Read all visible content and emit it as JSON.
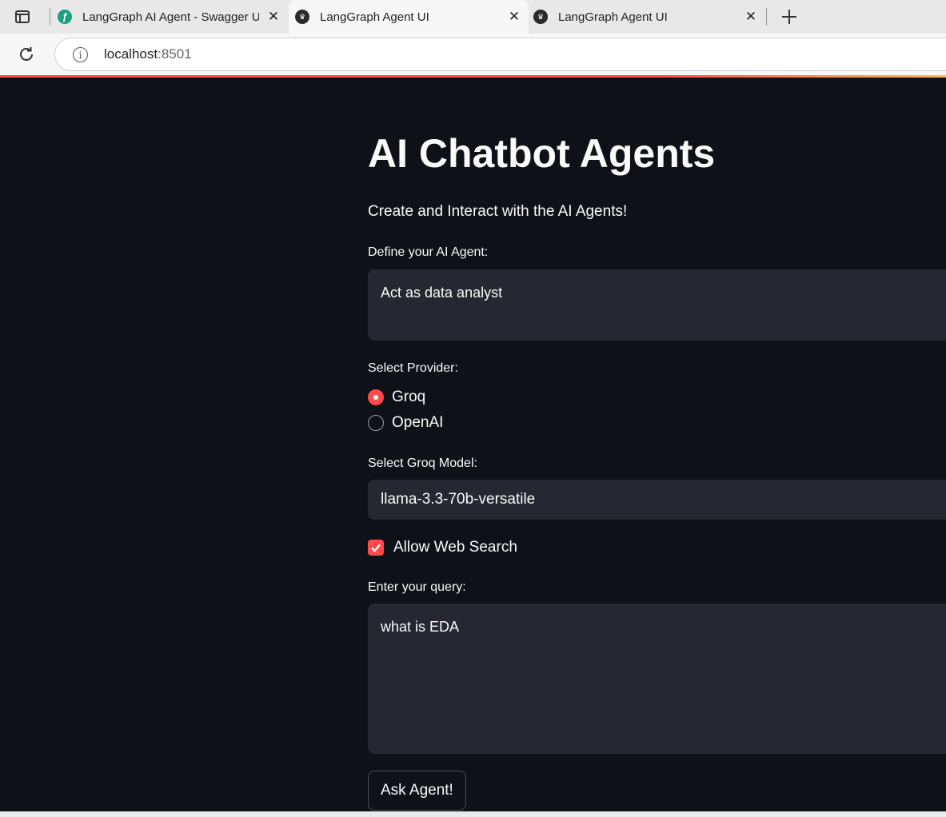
{
  "browser": {
    "tabs": [
      {
        "title": "LangGraph AI Agent - Swagger UI",
        "icon": "swagger-favicon-icon",
        "active": false
      },
      {
        "title": "LangGraph Agent UI",
        "icon": "streamlit-favicon-icon",
        "active": true
      },
      {
        "title": "LangGraph Agent UI",
        "icon": "streamlit-favicon-icon",
        "active": false
      }
    ],
    "url_host": "localhost",
    "url_port": ":8501"
  },
  "app": {
    "title": "AI Chatbot Agents",
    "subtitle": "Create and Interact with the AI Agents!",
    "agent_label": "Define your AI Agent:",
    "agent_value": "Act as data analyst",
    "provider_label": "Select Provider:",
    "providers": [
      {
        "label": "Groq",
        "selected": true
      },
      {
        "label": "OpenAI",
        "selected": false
      }
    ],
    "model_label": "Select Groq Model:",
    "model_value": "llama-3.3-70b-versatile",
    "web_search_label": "Allow Web Search",
    "web_search_checked": true,
    "query_label": "Enter your query:",
    "query_value": "what is EDA",
    "ask_button": "Ask Agent!"
  },
  "colors": {
    "accent": "#ff4b4b",
    "background": "#0e1117",
    "input_bg": "#262730",
    "text": "#fafafa"
  }
}
